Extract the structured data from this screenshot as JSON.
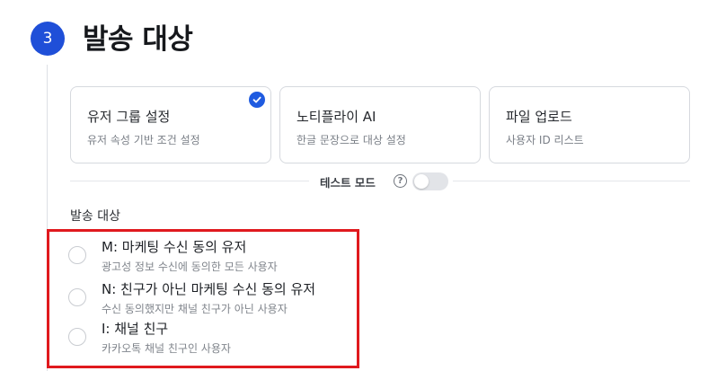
{
  "step": {
    "number": "3",
    "title": "발송 대상"
  },
  "cards": [
    {
      "title": "유저 그룹 설정",
      "subtitle": "유저 속성 기반 조건 설정",
      "selected": true
    },
    {
      "title": "노티플라이 AI",
      "subtitle": "한글 문장으로 대상 설정",
      "selected": false
    },
    {
      "title": "파일 업로드",
      "subtitle": "사용자 ID 리스트",
      "selected": false
    }
  ],
  "test_mode": {
    "label": "테스트 모드",
    "help_glyph": "?",
    "enabled": false
  },
  "target": {
    "label": "발송 대상",
    "options": [
      {
        "title": "M: 마케팅 수신 동의 유저",
        "subtitle": "광고성 정보 수신에 동의한 모든 사용자",
        "selected": false
      },
      {
        "title": "N: 친구가 아닌 마케팅 수신 동의 유저",
        "subtitle": "수신 동의했지만 채널 친구가 아닌 사용자",
        "selected": false
      },
      {
        "title": "I: 채널 친구",
        "subtitle": "카카오톡 채널 친구인 사용자",
        "selected": false
      }
    ]
  },
  "colors": {
    "accent": "#1f4fd8",
    "highlight_border": "#e0191e"
  }
}
